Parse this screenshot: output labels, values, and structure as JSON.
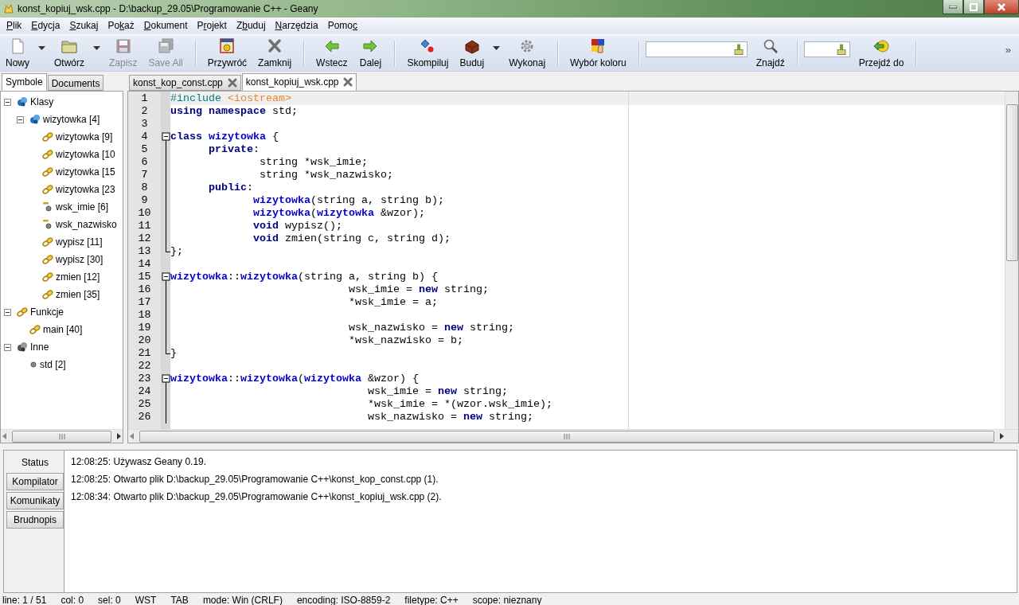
{
  "window": {
    "title": "konst_kopiuj_wsk.cpp - D:\\backup_29.05\\Programowanie C++ - Geany"
  },
  "menu": [
    {
      "key": "P",
      "post": "lik"
    },
    {
      "key": "E",
      "post": "dycja"
    },
    {
      "key": "S",
      "post": "zukaj"
    },
    {
      "pre": "Po",
      "key": "k",
      "post": "aż"
    },
    {
      "key": "D",
      "post": "okument"
    },
    {
      "pre": "P",
      "key": "r",
      "post": "ojekt"
    },
    {
      "pre": "Z",
      "key": "b",
      "post": "uduj"
    },
    {
      "key": "N",
      "post": "arzędzia"
    },
    {
      "pre": "Pomo",
      "key": "c"
    }
  ],
  "toolbar": {
    "items": [
      {
        "kind": "button",
        "label": "Nowy",
        "disabled": false,
        "dropdown": true
      },
      {
        "kind": "button",
        "label": "Otwórz",
        "disabled": false,
        "dropdown": true
      },
      {
        "kind": "button",
        "label": "Zapisz",
        "disabled": true,
        "dropdown": false
      },
      {
        "kind": "button",
        "label": "Save All",
        "disabled": true,
        "dropdown": false
      },
      {
        "kind": "separator"
      },
      {
        "kind": "button",
        "label": "Przywróć",
        "disabled": false,
        "dropdown": false
      },
      {
        "kind": "button",
        "label": "Zamknij",
        "disabled": false,
        "dropdown": false
      },
      {
        "kind": "separator"
      },
      {
        "kind": "button",
        "label": "Wstecz",
        "disabled": false,
        "dropdown": false
      },
      {
        "kind": "button",
        "label": "Dalej",
        "disabled": false,
        "dropdown": false
      },
      {
        "kind": "separator"
      },
      {
        "kind": "button",
        "label": "Skompiluj",
        "disabled": false,
        "dropdown": false
      },
      {
        "kind": "button",
        "label": "Buduj",
        "disabled": false,
        "dropdown": true
      },
      {
        "kind": "button",
        "label": "Wykonaj",
        "disabled": false,
        "dropdown": false
      },
      {
        "kind": "separator"
      },
      {
        "kind": "button",
        "label": "Wybór koloru",
        "disabled": false,
        "dropdown": false
      },
      {
        "kind": "separator"
      },
      {
        "kind": "field"
      },
      {
        "kind": "button",
        "label": "Znajdź",
        "disabled": false,
        "dropdown": false
      },
      {
        "kind": "separator"
      },
      {
        "kind": "field"
      },
      {
        "kind": "button",
        "label": "Przejdź do",
        "disabled": false,
        "dropdown": false
      },
      {
        "kind": "separator"
      }
    ],
    "overflow": "»"
  },
  "sidebar": {
    "tabs": [
      {
        "label": "Symbole",
        "selected": true
      },
      {
        "label": "Documents",
        "selected": false
      }
    ],
    "tree": [
      {
        "label": "Klasy",
        "kind": "class",
        "expanded": true,
        "children": [
          {
            "label": "wizytowka [4]",
            "kind": "class",
            "expanded": true,
            "children": [
              {
                "label": "wizytowka [9]",
                "kind": "function"
              },
              {
                "label": "wizytowka [10",
                "kind": "function"
              },
              {
                "label": "wizytowka [15",
                "kind": "function"
              },
              {
                "label": "wizytowka [23",
                "kind": "function"
              },
              {
                "label": "wsk_imie [6]",
                "kind": "variable"
              },
              {
                "label": "wsk_nazwisko",
                "kind": "variable"
              },
              {
                "label": "wypisz [11]",
                "kind": "function"
              },
              {
                "label": "wypisz [30]",
                "kind": "function"
              },
              {
                "label": "zmien [12]",
                "kind": "function"
              },
              {
                "label": "zmien [35]",
                "kind": "function"
              }
            ]
          }
        ]
      },
      {
        "label": "Funkcje",
        "kind": "function",
        "expanded": true,
        "children": [
          {
            "label": "main [40]",
            "kind": "function"
          }
        ]
      },
      {
        "label": "Inne",
        "kind": "other",
        "expanded": true,
        "children": [
          {
            "label": "std [2]",
            "kind": "namespace"
          }
        ]
      }
    ]
  },
  "editor": {
    "tabs": [
      {
        "label": "konst_kop_const.cpp",
        "selected": false
      },
      {
        "label": "konst_kopiuj_wsk.cpp",
        "selected": true
      }
    ],
    "lines": [
      {
        "number": "1",
        "current": true,
        "kind": "plain",
        "tokens": [
          {
            "kind": "preprocessor",
            "text": "#include"
          },
          {
            "kind": "include",
            "text": " <iostream>"
          }
        ]
      },
      {
        "number": "2",
        "current": false,
        "kind": "plain",
        "tokens": [
          {
            "kind": "keyword",
            "text": "using"
          },
          {
            "kind": "keyword",
            "text": " namespace"
          },
          {
            "kind": "plain",
            "text": " std;"
          }
        ]
      },
      {
        "number": "3",
        "current": false,
        "kind": "plain"
      },
      {
        "number": "4",
        "current": false,
        "kind": "fold-start",
        "tokens": [
          {
            "kind": "keyword",
            "text": "class"
          },
          {
            "kind": "class",
            "text": " wizytowka"
          },
          {
            "kind": "plain",
            "text": " {"
          }
        ]
      },
      {
        "number": "5",
        "current": false,
        "kind": "fold-body",
        "tokens": [
          {
            "kind": "keyword",
            "text": "      private"
          },
          {
            "kind": "plain",
            "text": ":"
          }
        ]
      },
      {
        "number": "6",
        "current": false,
        "kind": "fold-body",
        "tokens": [
          {
            "kind": "plain",
            "text": "              string *wsk_imie;"
          }
        ]
      },
      {
        "number": "7",
        "current": false,
        "kind": "fold-body",
        "tokens": [
          {
            "kind": "plain",
            "text": "              string *wsk_nazwisko;"
          }
        ]
      },
      {
        "number": "8",
        "current": false,
        "kind": "fold-body",
        "tokens": [
          {
            "kind": "keyword",
            "text": "      public"
          },
          {
            "kind": "plain",
            "text": ":"
          }
        ]
      },
      {
        "number": "9",
        "current": false,
        "kind": "fold-body",
        "tokens": [
          {
            "kind": "class",
            "text": "             wizytowka"
          },
          {
            "kind": "plain",
            "text": "(string a, string b);"
          }
        ]
      },
      {
        "number": "10",
        "current": false,
        "kind": "fold-body",
        "tokens": [
          {
            "kind": "class",
            "text": "             wizytowka"
          },
          {
            "kind": "plain",
            "text": "("
          },
          {
            "kind": "class",
            "text": "wizytowka"
          },
          {
            "kind": "plain",
            "text": " &wzor);"
          }
        ]
      },
      {
        "number": "11",
        "current": false,
        "kind": "fold-body",
        "tokens": [
          {
            "kind": "keyword",
            "text": "             void"
          },
          {
            "kind": "plain",
            "text": " wypisz();"
          }
        ]
      },
      {
        "number": "12",
        "current": false,
        "kind": "fold-body",
        "tokens": [
          {
            "kind": "keyword",
            "text": "             void"
          },
          {
            "kind": "plain",
            "text": " zmien(string c, string d);"
          }
        ]
      },
      {
        "number": "13",
        "current": false,
        "kind": "fold-end",
        "tokens": [
          {
            "kind": "plain",
            "text": "};"
          }
        ]
      },
      {
        "number": "14",
        "current": false,
        "kind": "plain"
      },
      {
        "number": "15",
        "current": false,
        "kind": "fold-start",
        "tokens": [
          {
            "kind": "class",
            "text": "wizytowka"
          },
          {
            "kind": "plain",
            "text": "::"
          },
          {
            "kind": "class",
            "text": "wizytowka"
          },
          {
            "kind": "plain",
            "text": "(string a, string b) {"
          }
        ]
      },
      {
        "number": "16",
        "current": false,
        "kind": "fold-body",
        "tokens": [
          {
            "kind": "plain",
            "text": "                            wsk_imie ="
          },
          {
            "kind": "keyword",
            "text": " new"
          },
          {
            "kind": "plain",
            "text": " string;"
          }
        ]
      },
      {
        "number": "17",
        "current": false,
        "kind": "fold-body",
        "tokens": [
          {
            "kind": "plain",
            "text": "                            *wsk_imie = a;"
          }
        ]
      },
      {
        "number": "18",
        "current": false,
        "kind": "fold-body"
      },
      {
        "number": "19",
        "current": false,
        "kind": "fold-body",
        "tokens": [
          {
            "kind": "plain",
            "text": "                            wsk_nazwisko ="
          },
          {
            "kind": "keyword",
            "text": " new"
          },
          {
            "kind": "plain",
            "text": " string;"
          }
        ]
      },
      {
        "number": "20",
        "current": false,
        "kind": "fold-body",
        "tokens": [
          {
            "kind": "plain",
            "text": "                            *wsk_nazwisko = b;"
          }
        ]
      },
      {
        "number": "21",
        "current": false,
        "kind": "fold-end",
        "tokens": [
          {
            "kind": "plain",
            "text": "}"
          }
        ]
      },
      {
        "number": "22",
        "current": false,
        "kind": "plain"
      },
      {
        "number": "23",
        "current": false,
        "kind": "fold-start",
        "tokens": [
          {
            "kind": "class",
            "text": "wizytowka"
          },
          {
            "kind": "plain",
            "text": "::"
          },
          {
            "kind": "class",
            "text": "wizytowka"
          },
          {
            "kind": "plain",
            "text": "("
          },
          {
            "kind": "class",
            "text": "wizytowka"
          },
          {
            "kind": "plain",
            "text": " &wzor) {"
          }
        ]
      },
      {
        "number": "24",
        "current": false,
        "kind": "fold-body",
        "tokens": [
          {
            "kind": "plain",
            "text": "                               wsk_imie ="
          },
          {
            "kind": "keyword",
            "text": " new"
          },
          {
            "kind": "plain",
            "text": " string;"
          }
        ]
      },
      {
        "number": "25",
        "current": false,
        "kind": "fold-body",
        "tokens": [
          {
            "kind": "plain",
            "text": "                               *wsk_imie = *(wzor.wsk_imie);"
          }
        ]
      },
      {
        "number": "26",
        "current": false,
        "kind": "fold-body",
        "tokens": [
          {
            "kind": "plain",
            "text": "                               wsk_nazwisko ="
          },
          {
            "kind": "keyword",
            "text": " new"
          },
          {
            "kind": "plain",
            "text": " string;"
          }
        ]
      }
    ]
  },
  "messages": {
    "tabs": [
      {
        "label": "Status",
        "selected": true
      },
      {
        "label": "Kompilator",
        "selected": false
      },
      {
        "label": "Komunikaty",
        "selected": false
      },
      {
        "label": "Brudnopis",
        "selected": false
      }
    ],
    "lines": [
      "12:08:25: Używasz Geany 0.19.",
      "12:08:25: Otwarto plik D:\\backup_29.05\\Programowanie C++\\konst_kop_const.cpp (1).",
      "12:08:34: Otwarto plik D:\\backup_29.05\\Programowanie C++\\konst_kopiuj_wsk.cpp (2)."
    ]
  },
  "status_bar": [
    "line: 1 / 51",
    "col: 0",
    "sel: 0",
    "WST",
    "TAB",
    "mode: Win (CRLF)",
    "encoding: ISO-8859-2",
    "filetype: C++",
    "scope: nieznany"
  ]
}
